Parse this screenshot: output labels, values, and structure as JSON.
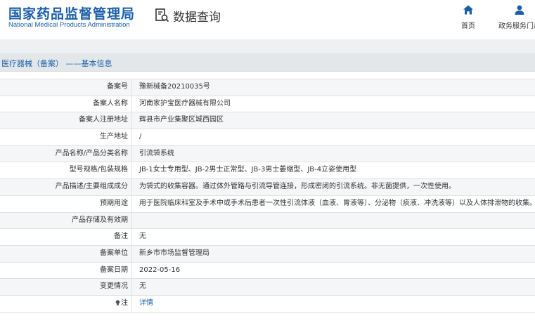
{
  "header": {
    "logo_cn": "国家药品监督管理局",
    "logo_en": "National Medical Products Administration",
    "query_title": "数据查询",
    "nav": {
      "home": "首页",
      "service": "政务服务门户"
    },
    "brand_color": "#1a5fa8"
  },
  "breadcrumb": "医疗器械（备案） ——基本信息",
  "rows": [
    {
      "k": "备案号",
      "v": "豫新械备20210035号"
    },
    {
      "k": "备案人名称",
      "v": "河南家护宝医疗器械有限公司"
    },
    {
      "k": "备案人注册地址",
      "v": "辉县市产业集聚区城西园区"
    },
    {
      "k": "生产地址",
      "v": "/"
    },
    {
      "k": "产品名称/产品分类名称",
      "v": "引流袋系统"
    },
    {
      "k": "型号规格/包装规格",
      "v": "JB-1女士专用型、JB-2男士正常型、JB-3男士萎缩型、JB-4立姿使用型"
    },
    {
      "k": "产品描述/主要组成成分",
      "v": "为袋式的收集容器。通过体外管路与引流导管连接，形成密闭的引流系统。非无菌提供，一次性使用。"
    },
    {
      "k": "预期用途",
      "v": "用于医院临床科室及手术中或手术后患者一次性引流体液（血液、胃液等）、分泌物（痰液、冲洗液等）以及人体排泄物的收集。"
    },
    {
      "k": "产品存储及有效期",
      "v": ""
    },
    {
      "k": "备注",
      "v": "无"
    },
    {
      "k": "备案单位",
      "v": "新乡市市场监督管理局"
    },
    {
      "k": "备案日期",
      "v": "2022-05-16"
    },
    {
      "k": "变更情况",
      "v": "无"
    },
    {
      "k": "注",
      "v": "详情"
    }
  ]
}
